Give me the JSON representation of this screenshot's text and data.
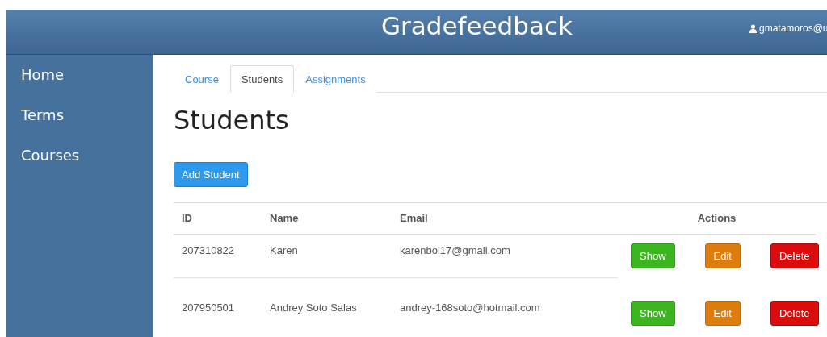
{
  "header": {
    "title": "Gradefeedback",
    "user": "gmatamoros@u"
  },
  "sidebar": {
    "items": [
      {
        "label": "Home"
      },
      {
        "label": "Terms"
      },
      {
        "label": "Courses"
      }
    ]
  },
  "tabs": [
    {
      "label": "Course",
      "selected": false
    },
    {
      "label": "Students",
      "selected": true
    },
    {
      "label": "Assignments",
      "selected": false
    }
  ],
  "page_title": "Students",
  "add_button": "Add Student",
  "table": {
    "columns": [
      "ID",
      "Name",
      "Email",
      "Actions"
    ],
    "rows": [
      {
        "id": "207310822",
        "name": "Karen",
        "email": "karenbol17@gmail.com",
        "actions": [
          {
            "kind": "show",
            "label": "Show"
          },
          {
            "kind": "edit",
            "label": "Edit"
          },
          {
            "kind": "delete",
            "label": "Delete"
          }
        ]
      },
      {
        "id": "207950501",
        "name": "Andrey Soto Salas",
        "email": "andrey-168soto@hotmail.com",
        "actions": [
          {
            "kind": "show",
            "label": "Show"
          },
          {
            "kind": "edit",
            "label": "Edit"
          },
          {
            "kind": "delete",
            "label": "Delete"
          }
        ]
      }
    ]
  }
}
